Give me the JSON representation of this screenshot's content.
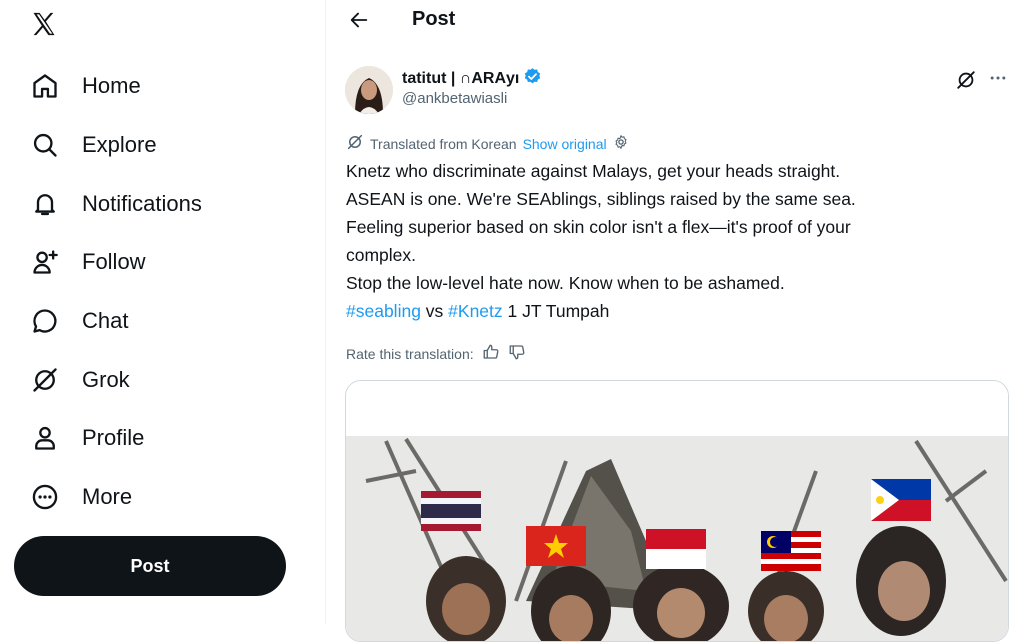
{
  "sidebar": {
    "logo_icon": "x-logo-icon",
    "items": [
      {
        "label": "Home",
        "icon": "home-icon"
      },
      {
        "label": "Explore",
        "icon": "search-icon"
      },
      {
        "label": "Notifications",
        "icon": "bell-icon"
      },
      {
        "label": "Follow",
        "icon": "add-person-icon"
      },
      {
        "label": "Chat",
        "icon": "chat-bubble-icon"
      },
      {
        "label": "Grok",
        "icon": "grok-icon"
      },
      {
        "label": "Profile",
        "icon": "person-icon"
      },
      {
        "label": "More",
        "icon": "more-circle-icon"
      }
    ],
    "post_button": "Post"
  },
  "header": {
    "title": "Post",
    "back_icon": "back-arrow-icon"
  },
  "tweet": {
    "display_name": "tatitut | ∩ARΑуı",
    "verified": true,
    "handle": "@ankbetawiasli",
    "translation": {
      "label": "Translated from Korean",
      "show_original": "Show original"
    },
    "text_lines": [
      "Knetz who discriminate against Malays, get your heads straight.",
      "ASEAN is one. We're SEAblings, siblings raised by the same sea.",
      "Feeling superior based on skin color isn't a flex—it's proof of your",
      "complex.",
      "Stop the low-level hate now. Know when to be ashamed."
    ],
    "hashtag_1": "#seabling",
    "connector": "vs",
    "hashtag_2": "#Knetz",
    "tail_text": " 1 JT Tumpah",
    "rate_label": "Rate this translation:"
  },
  "colors": {
    "accent": "#1d9bf0",
    "text": "#0f1419",
    "muted": "#536471",
    "post_button_bg": "#0f1419"
  }
}
